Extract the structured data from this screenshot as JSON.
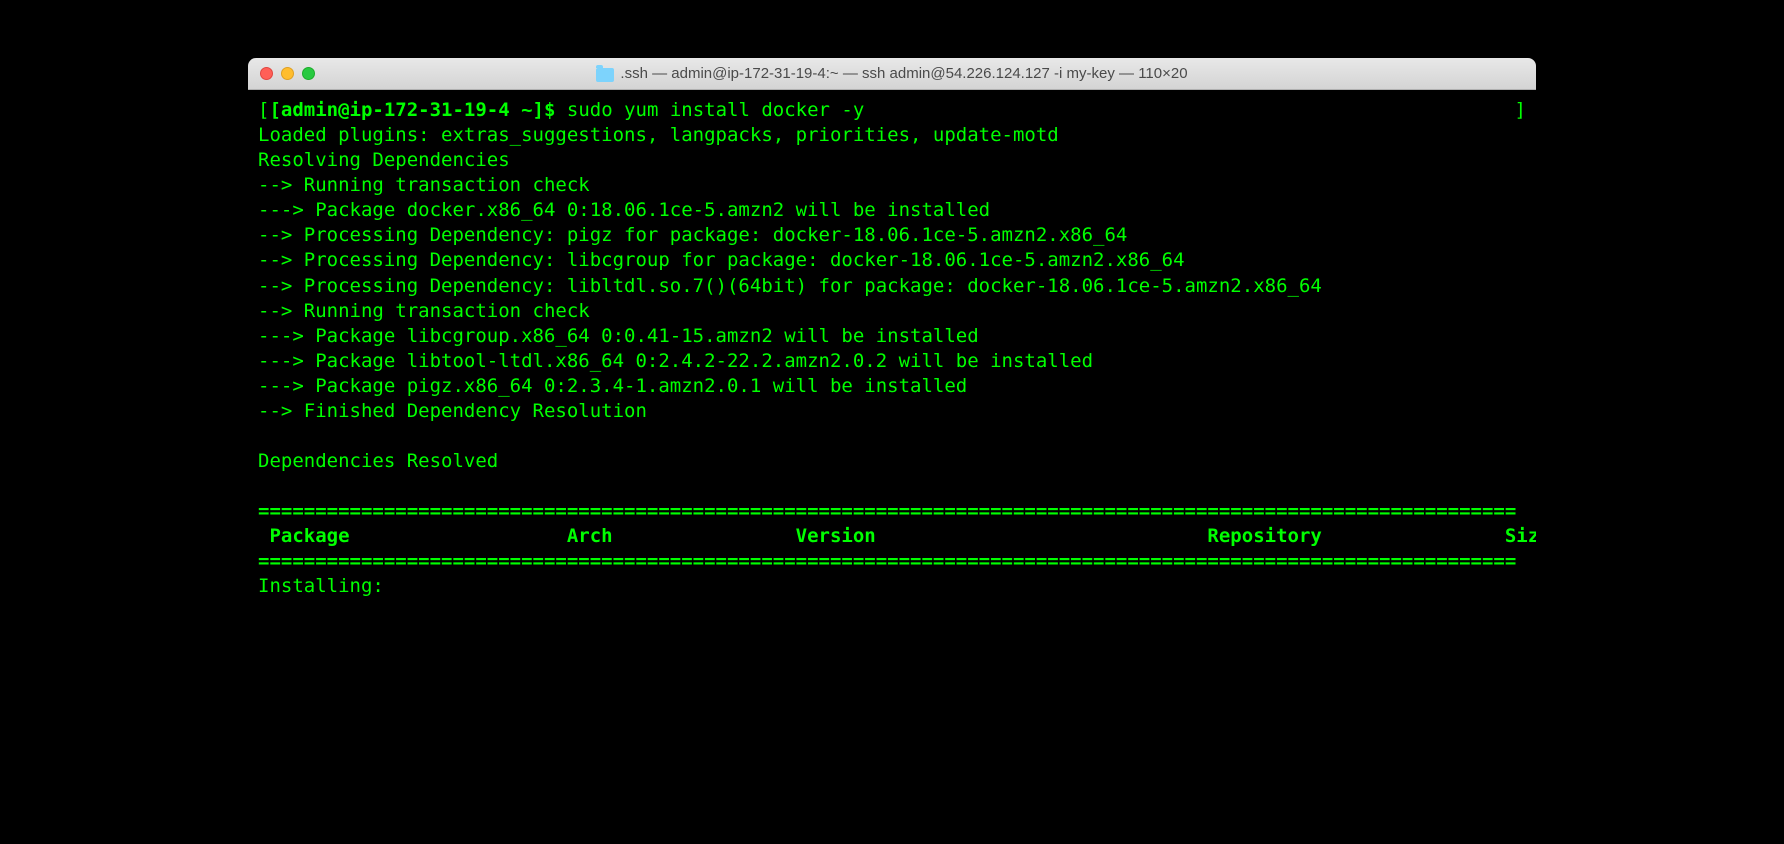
{
  "window": {
    "title": ".ssh — admin@ip-172-31-19-4:~ — ssh admin@54.226.124.127 -i my-key — 110×20"
  },
  "prompt": {
    "open_bracket": "[",
    "user_host": "[admin@ip-172-31-19-4 ~]$ ",
    "command": "sudo yum install docker -y",
    "close_bracket": "]"
  },
  "output": {
    "line1": "Loaded plugins: extras_suggestions, langpacks, priorities, update-motd",
    "line2": "Resolving Dependencies",
    "line3": "--> Running transaction check",
    "line4": "---> Package docker.x86_64 0:18.06.1ce-5.amzn2 will be installed",
    "line5": "--> Processing Dependency: pigz for package: docker-18.06.1ce-5.amzn2.x86_64",
    "line6": "--> Processing Dependency: libcgroup for package: docker-18.06.1ce-5.amzn2.x86_64",
    "line7": "--> Processing Dependency: libltdl.so.7()(64bit) for package: docker-18.06.1ce-5.amzn2.x86_64",
    "line8": "--> Running transaction check",
    "line9": "---> Package libcgroup.x86_64 0:0.41-15.amzn2 will be installed",
    "line10": "---> Package libtool-ltdl.x86_64 0:2.4.2-22.2.amzn2.0.2 will be installed",
    "line11": "---> Package pigz.x86_64 0:2.3.4-1.amzn2.0.1 will be installed",
    "line12": "--> Finished Dependency Resolution",
    "blank": " ",
    "resolved": "Dependencies Resolved",
    "sep": "==============================================================================================================",
    "header": " Package                   Arch                Version                             Repository                Size",
    "installing": "Installing:"
  }
}
